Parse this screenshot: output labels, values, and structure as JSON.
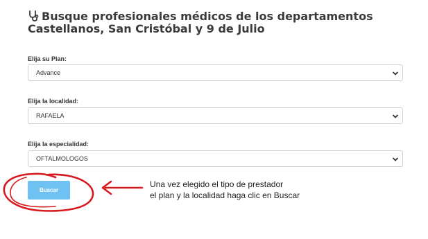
{
  "header": {
    "title_line1": "Busque profesionales médicos de los departamentos",
    "title_line2": "Castellanos, San Cristóbal y 9 de Julio",
    "icon": "stethoscope-icon"
  },
  "form": {
    "plan": {
      "label": "Elija su Plan:",
      "value": "Advance"
    },
    "locality": {
      "label": "Elija la localidad:",
      "value": "RAFAELA"
    },
    "specialty": {
      "label": "Elija la especialidad:",
      "value": "OFTALMOLOGOS"
    },
    "search_label": "Buscar"
  },
  "annotation": {
    "line1": "Una vez elegido el tipo de prestador",
    "line2": "el plan y la localidad haga clic en Buscar",
    "color": "#d7191f"
  },
  "colors": {
    "button": "#6ec1f0",
    "border": "#cfcfcf"
  }
}
